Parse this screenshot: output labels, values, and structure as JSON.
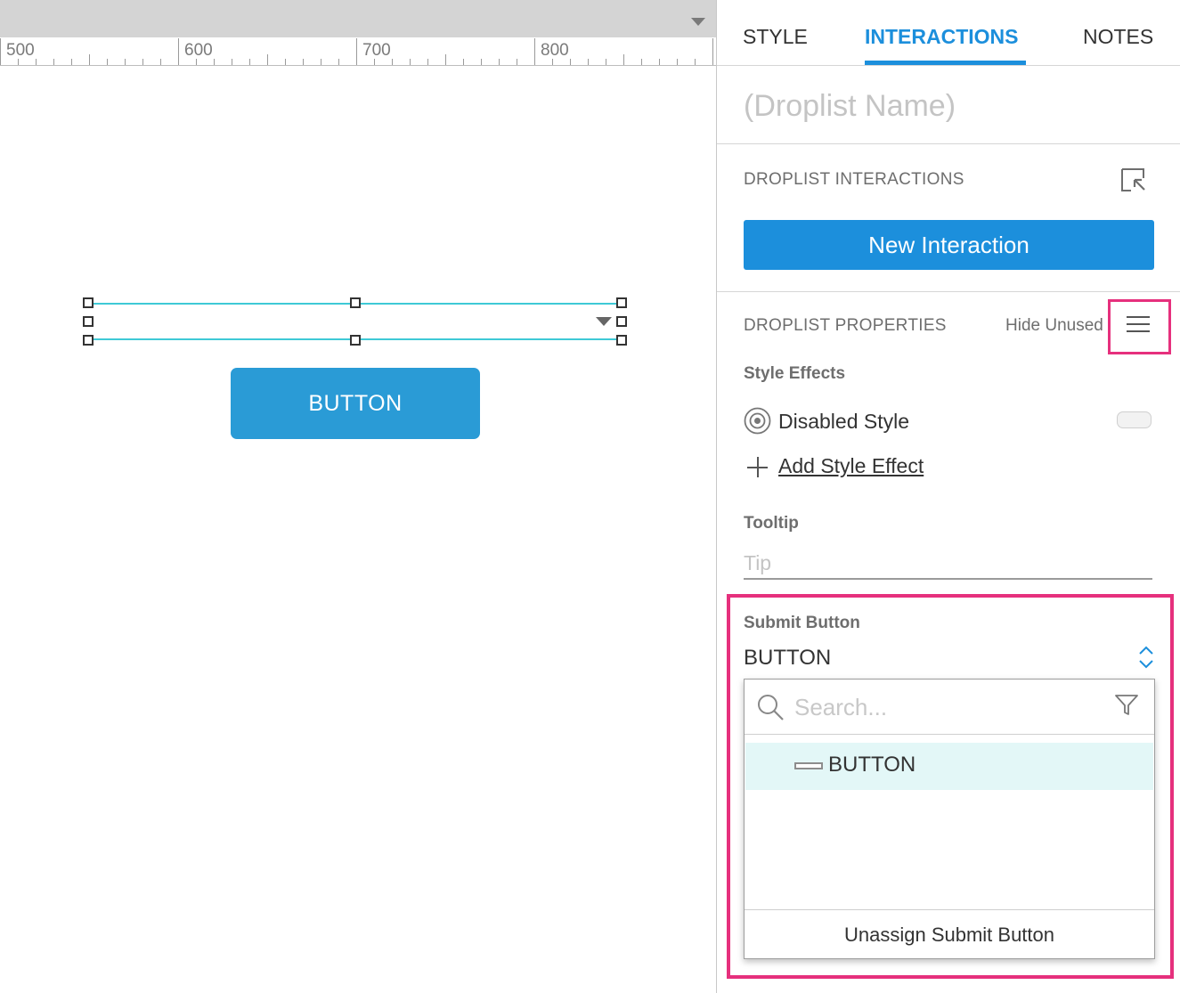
{
  "ruler": {
    "labels": [
      "500",
      "600",
      "700",
      "800"
    ]
  },
  "canvas": {
    "button_label": "BUTTON"
  },
  "panel": {
    "tabs": [
      {
        "label": "STYLE"
      },
      {
        "label": "INTERACTIONS"
      },
      {
        "label": "NOTES"
      }
    ],
    "active_tab": "INTERACTIONS",
    "widget_name_placeholder": "(Droplist Name)",
    "interactions_title": "DROPLIST INTERACTIONS",
    "new_interaction_label": "New Interaction",
    "properties_title": "DROPLIST PROPERTIES",
    "hide_unused_label": "Hide Unused",
    "style_effects": {
      "title": "Style Effects",
      "disabled_style_label": "Disabled Style",
      "add_style_effect_label": "Add Style Effect"
    },
    "tooltip": {
      "title": "Tooltip",
      "placeholder": "Tip"
    },
    "submit_button": {
      "title": "Submit Button",
      "value": "BUTTON",
      "search_placeholder": "Search...",
      "options": [
        {
          "label": "BUTTON"
        }
      ],
      "unassign_label": "Unassign Submit Button"
    }
  },
  "colors": {
    "accent": "#1c8fdc",
    "canvas_button": "#2a9bd6",
    "highlight": "#e6307d",
    "selection": "#3ec9d6",
    "selected_row": "#e3f7f7"
  },
  "icons": [
    "chevron-down-icon",
    "pointer-select-icon",
    "hamburger-menu-icon",
    "radio-target-icon",
    "plus-icon",
    "up-down-stepper-icon",
    "search-icon",
    "filter-icon",
    "button-widget-icon"
  ]
}
